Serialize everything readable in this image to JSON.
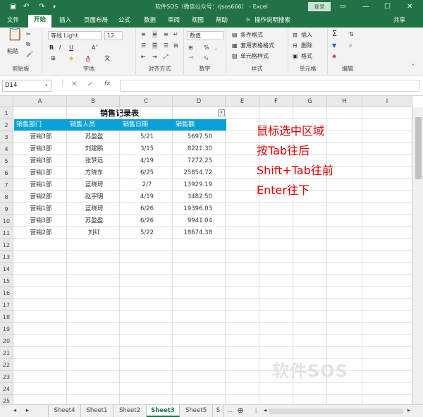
{
  "titlebar": {
    "title": "软件SOS（微信公众号：rjsos666） - Excel",
    "login_label": "登录",
    "save_icon": "save-icon",
    "undo_icon": "undo-icon",
    "redo_icon": "redo-icon",
    "win_min": "—",
    "win_max": "☐",
    "win_close": "✕"
  },
  "tabs": [
    "文件",
    "开始",
    "插入",
    "页面布局",
    "公式",
    "数据",
    "审阅",
    "视图",
    "帮助",
    "操作说明搜索"
  ],
  "share_label": "共享",
  "ribbon": {
    "clipboard": {
      "label": "剪贴板",
      "paste": "粘贴"
    },
    "font": {
      "label": "字体",
      "font_name": "等线 Light",
      "font_size": "12"
    },
    "align": {
      "label": "对齐方式"
    },
    "number": {
      "label": "数字",
      "format": "数值"
    },
    "styles": {
      "label": "样式",
      "cond": "条件格式",
      "table": "套用表格格式",
      "cell": "单元格样式"
    },
    "cells": {
      "label": "单元格",
      "insert": "插入",
      "delete": "删除",
      "format": "格式"
    },
    "edit": {
      "label": "编辑"
    }
  },
  "formula_bar": {
    "name_box": "D14",
    "fx": "fx",
    "cancel": "✕",
    "confirm": "✓",
    "content": ""
  },
  "columns": [
    "A",
    "B",
    "C",
    "D",
    "E",
    "F",
    "G",
    "H",
    "I"
  ],
  "rows": [
    "1",
    "2",
    "3",
    "4",
    "5",
    "6",
    "7",
    "8",
    "9",
    "10",
    "11",
    "12",
    "13",
    "14",
    "15",
    "16",
    "17",
    "18",
    "19",
    "20",
    "21",
    "22",
    "23",
    "24",
    "25"
  ],
  "table": {
    "title": "销售记录表",
    "headers": [
      "销售部门",
      "销售人员",
      "销售日期",
      "销售额"
    ],
    "data": [
      [
        "营销3部",
        "苏盈盈",
        "5/21",
        "5697.50"
      ],
      [
        "营销3部",
        "刘建鹏",
        "3/15",
        "8221.30"
      ],
      [
        "营销3部",
        "张梦远",
        "4/19",
        "7272.25"
      ],
      [
        "营销1部",
        "方晓东",
        "6/25",
        "25854.72"
      ],
      [
        "营销1部",
        "蓝晓琦",
        "2/7",
        "13929.19"
      ],
      [
        "营销2部",
        "赵宇明",
        "4/19",
        "3482.50"
      ],
      [
        "营销1部",
        "蓝晓琦",
        "6/26",
        "19396.03"
      ],
      [
        "营销3部",
        "苏盈盈",
        "6/26",
        "9941.04"
      ],
      [
        "营销2部",
        "刘红",
        "5/22",
        "18674.38"
      ]
    ]
  },
  "annotation": [
    "鼠标选中区域",
    "按Tab往后",
    "Shift+Tab往前",
    "Enter往下"
  ],
  "sheets": [
    "Sheet4",
    "Sheet1",
    "Sheet2",
    "Sheet3",
    "Sheet5",
    "S"
  ],
  "active_sheet": "Sheet3",
  "watermark": "软件SOS",
  "colors": {
    "accent": "#217346",
    "table_header": "#0aa1d8",
    "annotation": "#e00000"
  }
}
